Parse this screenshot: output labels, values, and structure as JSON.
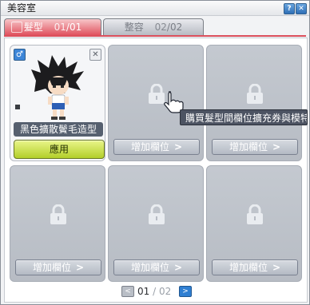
{
  "window": {
    "title": "美容室"
  },
  "tabs": [
    {
      "label": "髮型",
      "current": "01",
      "total": "01",
      "active": true
    },
    {
      "label": "整容",
      "current": "02",
      "total": "02",
      "active": false
    }
  ],
  "slots": {
    "filled": {
      "gender_symbol": "♂",
      "close_symbol": "✕",
      "name": "黑色擴散鬢毛造型",
      "apply_label": "應用"
    },
    "add_label": "增加欄位",
    "chevron": ">"
  },
  "tooltip": {
    "text": "購買髮型間欄位擴充券與模特"
  },
  "pager": {
    "current": "01",
    "separator": " / ",
    "total": "02",
    "prev": "<",
    "next": ">"
  },
  "colors": {
    "active_tab": "#e0525f",
    "apply": "#b3cf2a",
    "next_btn": "#2f7fd2"
  }
}
